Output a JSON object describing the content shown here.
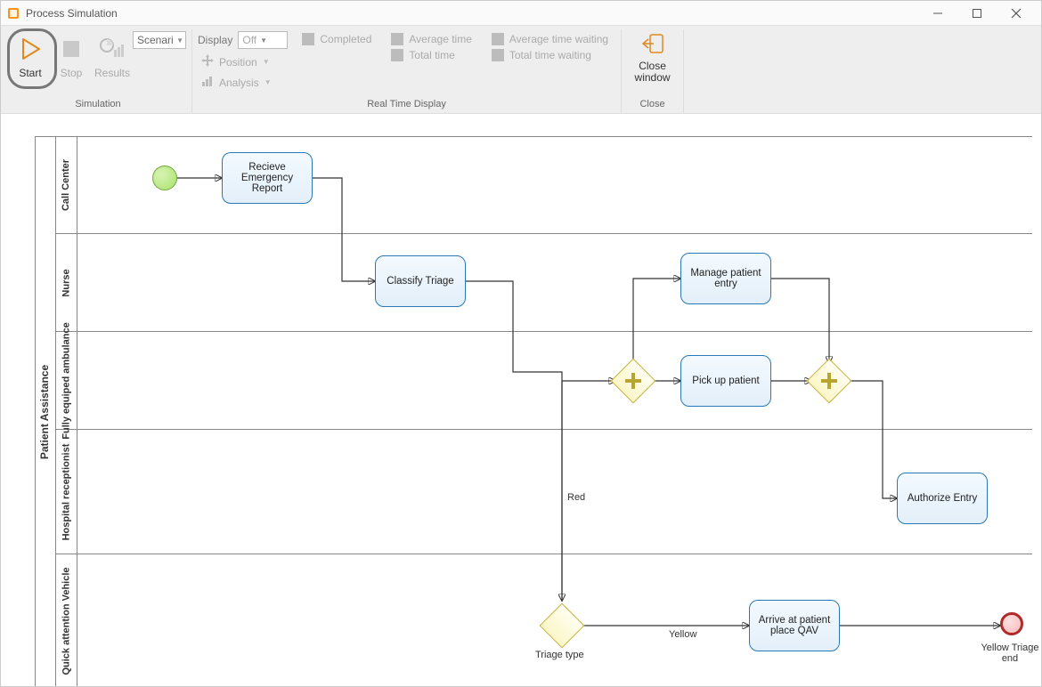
{
  "window": {
    "title": "Process Simulation"
  },
  "ribbon": {
    "simulation": {
      "group_label": "Simulation",
      "start": "Start",
      "stop": "Stop",
      "results": "Results",
      "scenario": "Scenari"
    },
    "rtd": {
      "group_label": "Real Time Display",
      "display": "Display",
      "display_value": "Off",
      "position": "Position",
      "analysis": "Analysis",
      "completed": "Completed",
      "total_time": "Total time",
      "avg_time": "Average time",
      "avg_time_waiting": "Average time waiting",
      "total_time_waiting": "Total time waiting"
    },
    "close": {
      "group_label": "Close",
      "close_window": "Close window"
    }
  },
  "diagram": {
    "pool": "Patient Assistance",
    "lanes": {
      "call_center": "Call Center",
      "nurse": "Nurse",
      "ambulance": "Fully equiped ambulance",
      "receptionist": "Hospital receptionist",
      "qav": "Quick attention Vehicle"
    },
    "tasks": {
      "recieve": "Recieve Emergency Report",
      "classify": "Classify Triage",
      "manage_entry": "Manage patient entry",
      "pickup": "Pick up patient",
      "authorize": "Authorize Entry",
      "arrive_qav": "Arrive at patient place QAV"
    },
    "gateways": {
      "triage_type": "Triage type"
    },
    "flow_labels": {
      "red": "Red",
      "yellow": "Yellow"
    },
    "end_events": {
      "yellow_end": "Yellow Triage end"
    }
  }
}
